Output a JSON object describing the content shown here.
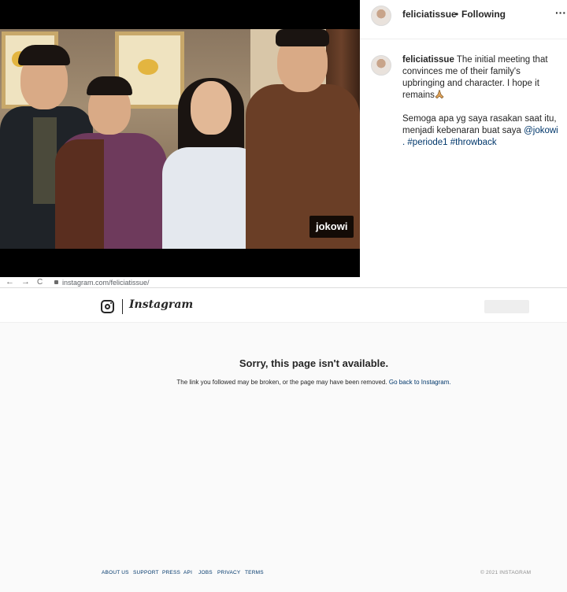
{
  "post": {
    "photo_tag": "jokowi",
    "header": {
      "username": "feliciatissue",
      "separator": "•",
      "follow_status": "Following"
    },
    "caption": {
      "username": "feliciatissue",
      "text_1": "The initial meeting that convinces me of their family's upbringing and character. I hope it remains",
      "text_2": "Semoga apa yg saya rasakan saat itu, menjadi kebenaran buat saya",
      "mention": "@jokowi",
      "period": ".",
      "hashtag_1": "#periode1",
      "hashtag_2": "#throwback"
    },
    "icons": [
      "more-options-icon",
      "praying-hands-icon",
      "avatar"
    ]
  },
  "browser": {
    "back": "←",
    "forward": "→",
    "reload": "C",
    "url": "instagram.com/feliciatissue/"
  },
  "instagram": {
    "wordmark": "Instagram",
    "error_title": "Sorry, this page isn't available.",
    "error_text": "The link you followed may be broken, or the page may have been removed.",
    "error_link": "Go back to Instagram.",
    "footer_links": [
      "ABOUT US",
      "SUPPORT",
      "PRESS",
      "API",
      "JOBS",
      "PRIVACY",
      "TERMS"
    ],
    "copyright": "© 2021 INSTAGRAM",
    "colors": {
      "link": "#00376b",
      "text": "#262626",
      "page_bg": "#fafafa"
    }
  }
}
